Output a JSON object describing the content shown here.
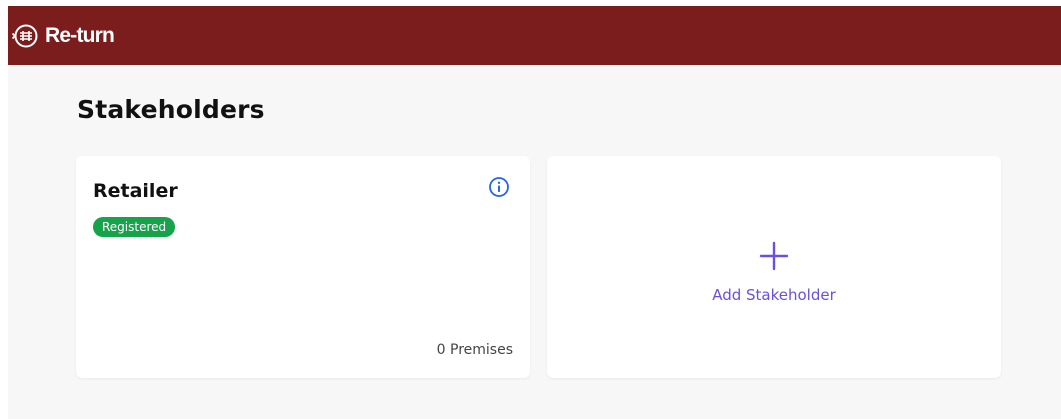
{
  "app": {
    "brand_name": "Re-turn",
    "brand_icon": "recycle-logo-icon",
    "header_color": "#7c1d1d"
  },
  "page": {
    "title": "Stakeholders"
  },
  "stakeholders": [
    {
      "name": "Retailer",
      "status": "Registered",
      "status_color": "#16a34a",
      "premises": "0 Premises",
      "info_icon": "info-icon"
    }
  ],
  "add_card": {
    "icon": "plus-icon",
    "label": "Add Stakeholder",
    "accent_color": "#6b4fe0"
  }
}
